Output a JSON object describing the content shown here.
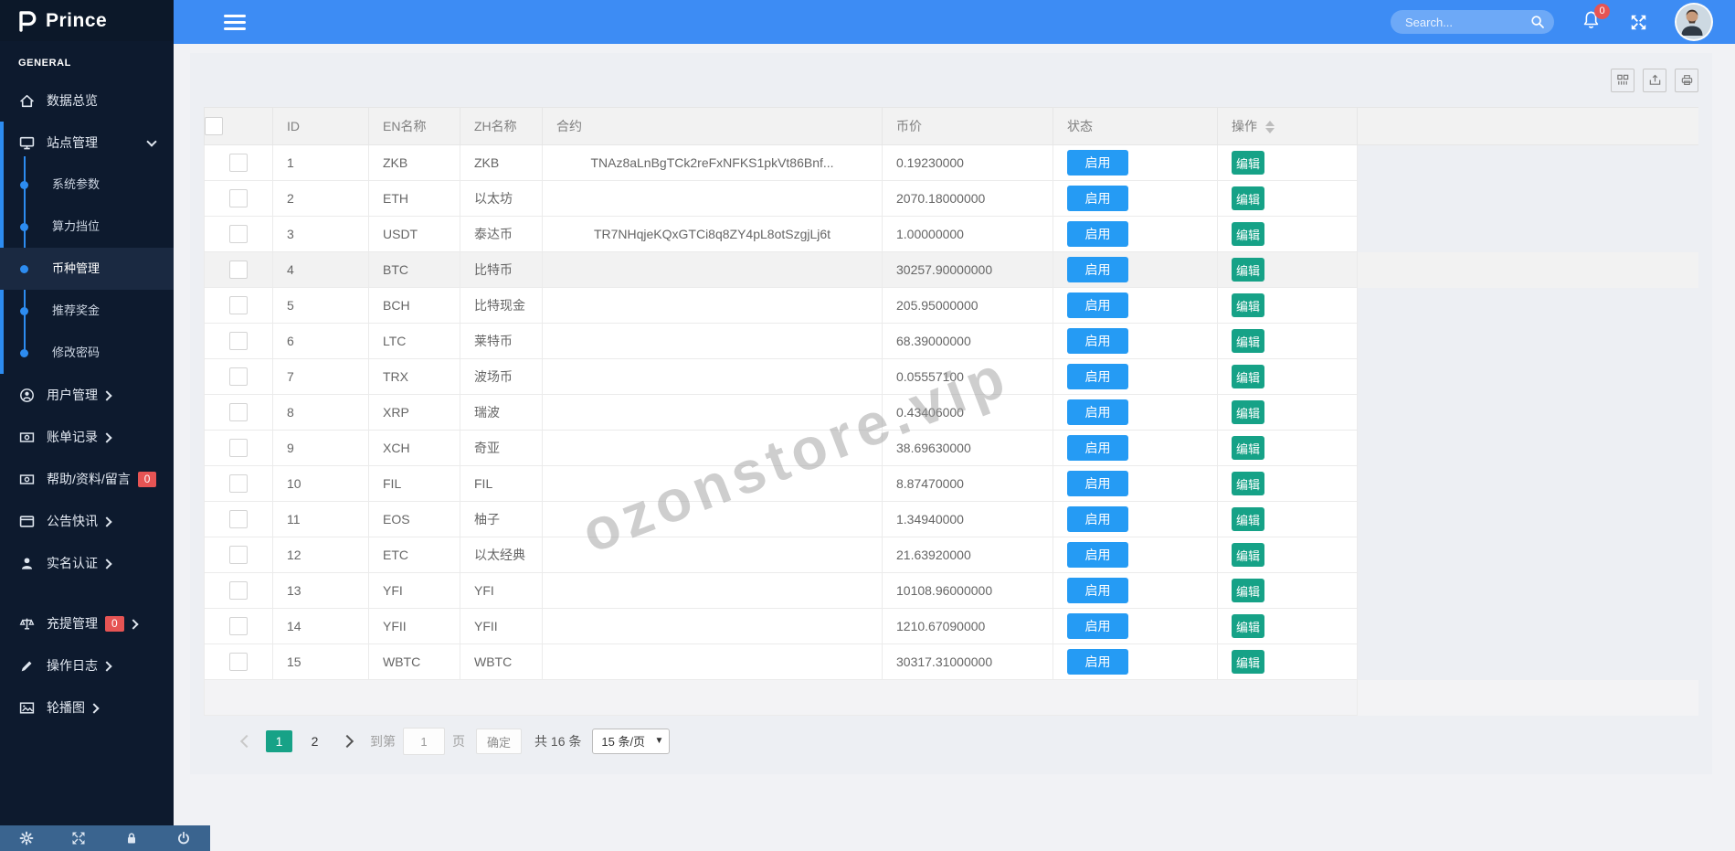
{
  "brand": {
    "name": "Prince"
  },
  "topbar": {
    "search_placeholder": "Search...",
    "notification_count": "0",
    "icons": [
      "bell-icon",
      "fullscreen-icon",
      "avatar"
    ]
  },
  "sidebar": {
    "section_label": "GENERAL",
    "items": [
      {
        "label": "数据总览",
        "icon": "home-icon"
      },
      {
        "label": "站点管理",
        "icon": "monitor-icon",
        "expanded": true
      },
      {
        "label": "用户管理",
        "icon": "user-circle-icon",
        "arrow": true
      },
      {
        "label": "账单记录",
        "icon": "bill-icon",
        "arrow": true
      },
      {
        "label": "帮助/资料/留言",
        "icon": "bill-icon",
        "badge": "0"
      },
      {
        "label": "公告快讯",
        "icon": "window-icon",
        "arrow": true
      },
      {
        "label": "实名认证",
        "icon": "person-icon",
        "arrow": true
      },
      {
        "label": "充提管理",
        "icon": "scale-icon",
        "badge": "0",
        "arrow": true
      },
      {
        "label": "操作日志",
        "icon": "pen-icon",
        "arrow": true
      },
      {
        "label": "轮播图",
        "icon": "image-icon",
        "arrow": true
      }
    ],
    "submenu": [
      {
        "label": "系统参数"
      },
      {
        "label": "算力挡位"
      },
      {
        "label": "币种管理",
        "active": true
      },
      {
        "label": "推荐奖金"
      },
      {
        "label": "修改密码"
      }
    ],
    "footer_icons": [
      "gear-icon",
      "expand-icon",
      "lock-icon",
      "power-icon"
    ]
  },
  "card_toolbar": {
    "icons": [
      "columns-icon",
      "export-icon",
      "print-icon"
    ]
  },
  "table": {
    "headers": [
      "ID",
      "EN名称",
      "ZH名称",
      "合约",
      "币价",
      "状态",
      "操作"
    ],
    "status_label": "启用",
    "action_label": "编辑",
    "highlighted_row_id": "4",
    "rows": [
      {
        "id": "1",
        "en": "ZKB",
        "zh": "ZKB",
        "contract": "TNAz8aLnBgTCk2reFxNFKS1pkVt86Bnf...",
        "price": "0.19230000"
      },
      {
        "id": "2",
        "en": "ETH",
        "zh": "以太坊",
        "contract": "",
        "price": "2070.18000000"
      },
      {
        "id": "3",
        "en": "USDT",
        "zh": "泰达币",
        "contract": "TR7NHqjeKQxGTCi8q8ZY4pL8otSzgjLj6t",
        "price": "1.00000000"
      },
      {
        "id": "4",
        "en": "BTC",
        "zh": "比特币",
        "contract": "",
        "price": "30257.90000000"
      },
      {
        "id": "5",
        "en": "BCH",
        "zh": "比特现金",
        "contract": "",
        "price": "205.95000000"
      },
      {
        "id": "6",
        "en": "LTC",
        "zh": "莱特币",
        "contract": "",
        "price": "68.39000000"
      },
      {
        "id": "7",
        "en": "TRX",
        "zh": "波场币",
        "contract": "",
        "price": "0.05557100"
      },
      {
        "id": "8",
        "en": "XRP",
        "zh": "瑞波",
        "contract": "",
        "price": "0.43406000"
      },
      {
        "id": "9",
        "en": "XCH",
        "zh": "奇亚",
        "contract": "",
        "price": "38.69630000"
      },
      {
        "id": "10",
        "en": "FIL",
        "zh": "FIL",
        "contract": "",
        "price": "8.87470000"
      },
      {
        "id": "11",
        "en": "EOS",
        "zh": "柚子",
        "contract": "",
        "price": "1.34940000"
      },
      {
        "id": "12",
        "en": "ETC",
        "zh": "以太经典",
        "contract": "",
        "price": "21.63920000"
      },
      {
        "id": "13",
        "en": "YFI",
        "zh": "YFI",
        "contract": "",
        "price": "10108.96000000"
      },
      {
        "id": "14",
        "en": "YFII",
        "zh": "YFII",
        "contract": "",
        "price": "1210.67090000"
      },
      {
        "id": "15",
        "en": "WBTC",
        "zh": "WBTC",
        "contract": "",
        "price": "30317.31000000"
      }
    ]
  },
  "pagination": {
    "pages": [
      "1",
      "2"
    ],
    "active_page": "1",
    "goto_label": "到第",
    "goto_value": "1",
    "page_label": "页",
    "confirm_label": "确定",
    "total_label": "共 16 条",
    "page_size_label": "15 条/页"
  },
  "watermark": "ozonstore.vip",
  "colors": {
    "topbar": "#3d8cf4",
    "sidebar": "#0d1a2e",
    "accent": "#2d8cf0",
    "enable_btn": "#259bf4",
    "edit_btn": "#16a287",
    "badge": "#e65454",
    "active_page": "#17a287"
  }
}
